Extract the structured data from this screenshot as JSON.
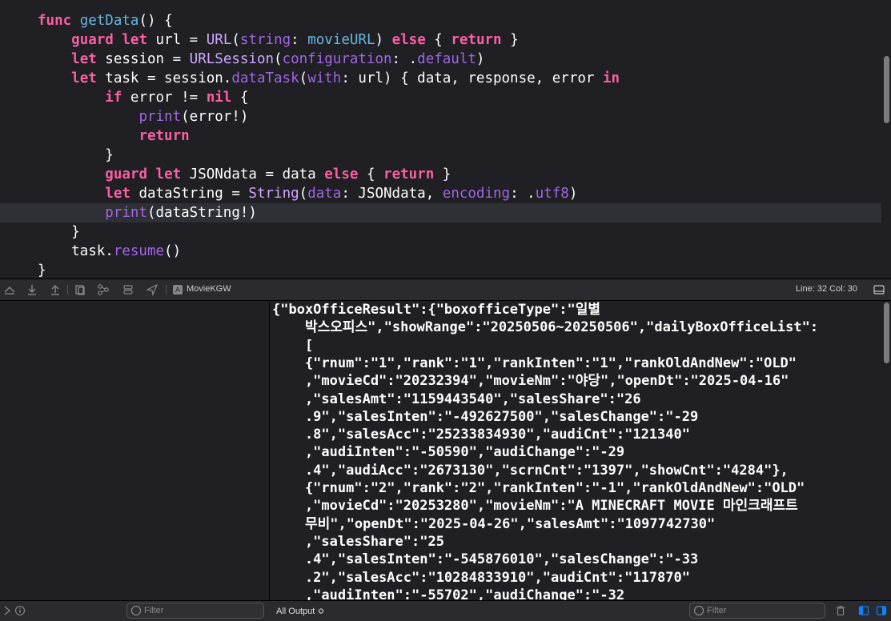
{
  "editor": {
    "lines": [
      [
        [
          "kw",
          "func"
        ],
        [
          "t",
          " "
        ],
        [
          "fn",
          "getData"
        ],
        [
          "t",
          "() {"
        ]
      ],
      [
        [
          "t",
          "    "
        ],
        [
          "kw",
          "guard"
        ],
        [
          "t",
          " "
        ],
        [
          "kw",
          "let"
        ],
        [
          "t",
          " url = "
        ],
        [
          "tp",
          "URL"
        ],
        [
          "t",
          "("
        ],
        [
          "pa",
          "string"
        ],
        [
          "t",
          ": "
        ],
        [
          "fn",
          "movieURL"
        ],
        [
          "t",
          ") "
        ],
        [
          "kw",
          "else"
        ],
        [
          "t",
          " { "
        ],
        [
          "kw",
          "return"
        ],
        [
          "t",
          " }"
        ]
      ],
      [
        [
          "t",
          "    "
        ],
        [
          "kw",
          "let"
        ],
        [
          "t",
          " session = "
        ],
        [
          "tp",
          "URLSession"
        ],
        [
          "t",
          "("
        ],
        [
          "pa",
          "configuration"
        ],
        [
          "t",
          ": ."
        ],
        [
          "mb",
          "default"
        ],
        [
          "t",
          ")"
        ]
      ],
      [
        [
          "t",
          "    "
        ],
        [
          "kw",
          "let"
        ],
        [
          "t",
          " task = session."
        ],
        [
          "mb",
          "dataTask"
        ],
        [
          "t",
          "("
        ],
        [
          "pa",
          "with"
        ],
        [
          "t",
          ": url) { data, response, error "
        ],
        [
          "kw",
          "in"
        ]
      ],
      [
        [
          "t",
          "        "
        ],
        [
          "kw",
          "if"
        ],
        [
          "t",
          " error != "
        ],
        [
          "kw",
          "nil"
        ],
        [
          "t",
          " {"
        ]
      ],
      [
        [
          "t",
          "            "
        ],
        [
          "mb",
          "print"
        ],
        [
          "t",
          "(error!)"
        ]
      ],
      [
        [
          "t",
          "            "
        ],
        [
          "kw",
          "return"
        ]
      ],
      [
        [
          "t",
          "        }"
        ]
      ],
      [
        [
          "t",
          "        "
        ],
        [
          "kw",
          "guard"
        ],
        [
          "t",
          " "
        ],
        [
          "kw",
          "let"
        ],
        [
          "t",
          " JSONdata = data "
        ],
        [
          "kw",
          "else"
        ],
        [
          "t",
          " { "
        ],
        [
          "kw",
          "return"
        ],
        [
          "t",
          " }"
        ]
      ],
      [
        [
          "t",
          "        "
        ],
        [
          "kw",
          "let"
        ],
        [
          "t",
          " dataString = "
        ],
        [
          "tp",
          "String"
        ],
        [
          "t",
          "("
        ],
        [
          "pa",
          "data"
        ],
        [
          "t",
          ": JSONdata, "
        ],
        [
          "pa",
          "encoding"
        ],
        [
          "t",
          ": ."
        ],
        [
          "mb",
          "utf8"
        ],
        [
          "t",
          ")"
        ]
      ],
      [
        [
          "t",
          "        "
        ],
        [
          "mb",
          "print"
        ],
        [
          "t",
          "(dataString!)"
        ]
      ],
      [
        [
          "t",
          "    }"
        ]
      ],
      [
        [
          "t",
          "    task."
        ],
        [
          "mb",
          "resume"
        ],
        [
          "t",
          "()"
        ]
      ],
      [
        [
          "t",
          "}"
        ]
      ]
    ],
    "highlighted_line_index": 10
  },
  "debugbar": {
    "scheme": "MovieKGW",
    "line_col": "Line: 32  Col: 30",
    "icons": [
      "hide-debug-icon",
      "step-over-icon",
      "step-in-icon",
      "step-out-icon",
      "view-hierarchy-icon",
      "memory-graph-icon",
      "environment-icon",
      "location-icon"
    ]
  },
  "console": {
    "lines": [
      "{\"boxOfficeResult\":{\"boxofficeType\":\"일별",
      "    박스오피스\",\"showRange\":\"20250506~20250506\",\"dailyBoxOfficeList\":",
      "    [",
      "    {\"rnum\":\"1\",\"rank\":\"1\",\"rankInten\":\"1\",\"rankOldAndNew\":\"OLD\"",
      "    ,\"movieCd\":\"20232394\",\"movieNm\":\"야당\",\"openDt\":\"2025-04-16\"",
      "    ,\"salesAmt\":\"1159443540\",\"salesShare\":\"26",
      "    .9\",\"salesInten\":\"-492627500\",\"salesChange\":\"-29",
      "    .8\",\"salesAcc\":\"25233834930\",\"audiCnt\":\"121340\"",
      "    ,\"audiInten\":\"-50590\",\"audiChange\":\"-29",
      "    .4\",\"audiAcc\":\"2673130\",\"scrnCnt\":\"1397\",\"showCnt\":\"4284\"},",
      "    {\"rnum\":\"2\",\"rank\":\"2\",\"rankInten\":\"-1\",\"rankOldAndNew\":\"OLD\"",
      "    ,\"movieCd\":\"20253280\",\"movieNm\":\"A MINECRAFT MOVIE 마인크래프트",
      "    무비\",\"openDt\":\"2025-04-26\",\"salesAmt\":\"1097742730\"",
      "    ,\"salesShare\":\"25",
      "    .4\",\"salesInten\":\"-545876010\",\"salesChange\":\"-33",
      "    .2\",\"salesAcc\":\"10284833910\",\"audiCnt\":\"117870\"",
      "    ,\"audiInten\":\"-55702\",\"audiChange\":\"-32"
    ]
  },
  "bottombar": {
    "left_filter_placeholder": "Filter",
    "output_selector": "All Output ≎",
    "right_filter_placeholder": "Filter"
  },
  "colors": {
    "keyword": "#fc5fa3",
    "function": "#67b7e1",
    "type": "#d0a8ff",
    "param": "#a167e6",
    "accent": "#0a84ff"
  }
}
